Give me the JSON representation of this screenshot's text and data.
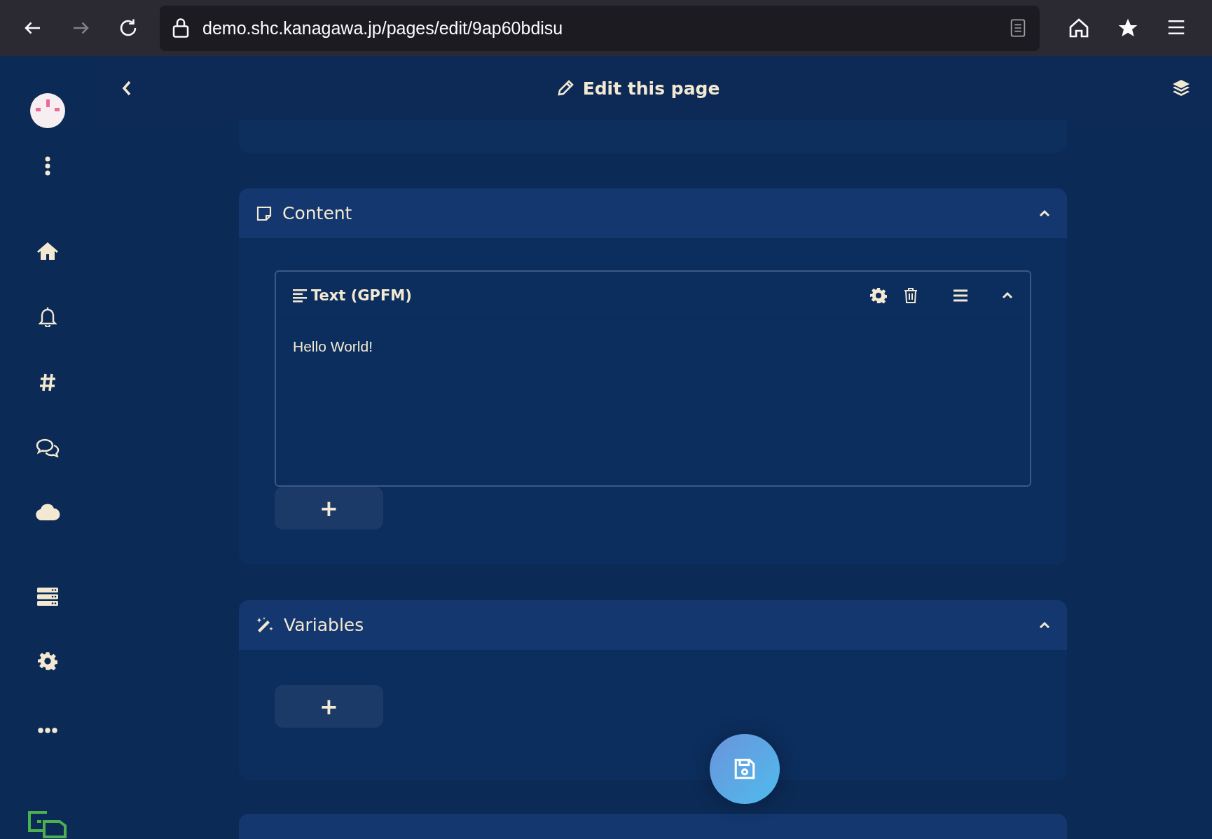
{
  "browser": {
    "url": "demo.shc.kanagawa.jp/pages/edit/9ap60bdisu",
    "forward_disabled": true
  },
  "header": {
    "title": "Edit this page"
  },
  "sections": [
    {
      "kind": "content",
      "title": "Content",
      "expanded": true,
      "blocks": [
        {
          "title": "Text (GPFM)",
          "text": "Hello World!",
          "expanded": true
        }
      ],
      "add_label": "+"
    },
    {
      "kind": "variables",
      "title": "Variables",
      "expanded": true,
      "add_label": "+"
    }
  ]
}
